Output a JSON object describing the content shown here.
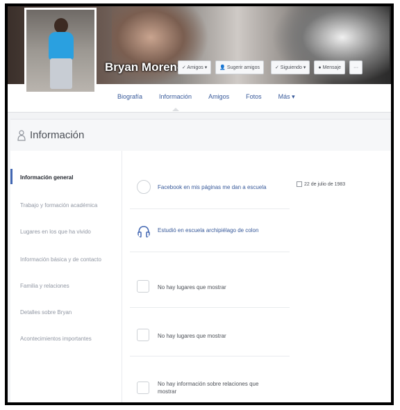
{
  "profile": {
    "name": "Bryan Moreno",
    "actions": [
      {
        "label": "✓ Amigos ▾",
        "icon": "checkmark-icon"
      },
      {
        "label": "👤 Sugerir amigos",
        "icon": "person-icon"
      },
      {
        "label": "✓ Siguiendo ▾",
        "icon": "checkmark-icon"
      },
      {
        "label": "● Mensaje",
        "icon": "message-icon"
      },
      {
        "label": "···",
        "icon": "more-icon"
      }
    ]
  },
  "nav": {
    "tabs": [
      "Biografía",
      "Información",
      "Amigos",
      "Fotos",
      "Más ▾"
    ],
    "active_tab": "Información"
  },
  "section": {
    "title": "Información",
    "icon": "person-icon"
  },
  "sidebar": {
    "items": [
      "Información general",
      "Trabajo y formación académica",
      "Lugares en los que ha vivido",
      "Información básica y de contacto",
      "Familia y relaciones",
      "Detalles sobre Bryan",
      "Acontecimientos importantes"
    ],
    "active_index": 0
  },
  "overview": {
    "rows": [
      {
        "text": "Facebook en mis páginas me dan a escuela",
        "icon": "clock-icon"
      },
      {
        "text": "Estudió en escuela archipiélago de colon",
        "icon": "headphones-icon"
      },
      {
        "text": "No hay lugares que mostrar",
        "icon": "pin-icon"
      },
      {
        "text": "No hay lugares que mostrar",
        "icon": "pin-icon"
      },
      {
        "text": "No hay información sobre relaciones que mostrar",
        "icon": "heart-icon"
      }
    ],
    "birthday": "22 de julio de 1983"
  }
}
